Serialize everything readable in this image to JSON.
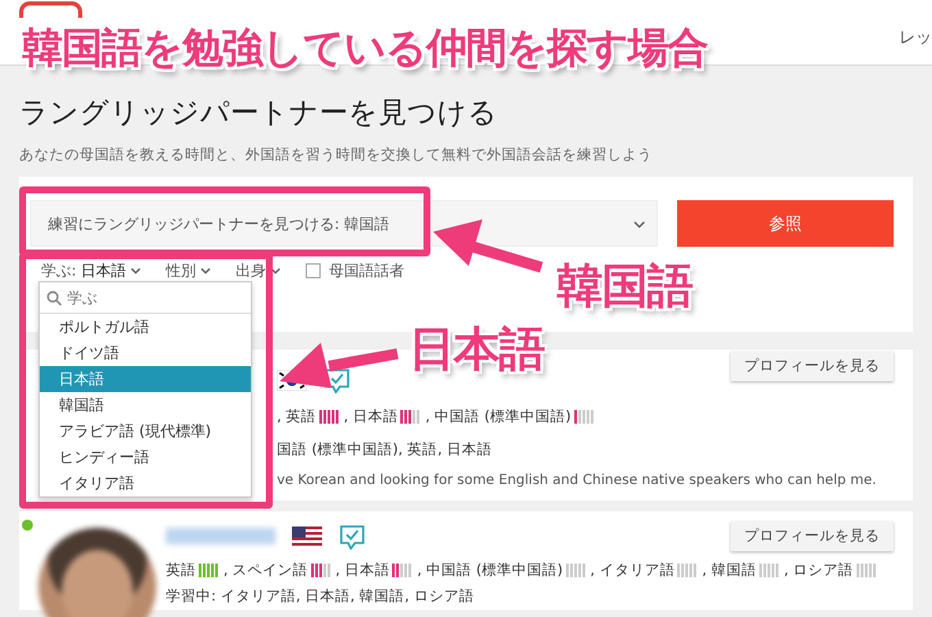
{
  "header": {
    "nav_item": "レッ"
  },
  "page": {
    "title": "ラングリッジパートナーを見つける",
    "subtitle": "あなたの母国語を教える時間と、外国語を習う時間を交換して無料で外国語会話を練習しよう"
  },
  "search": {
    "select_value": "練習にラングリッジパートナーを見つける: 韓国語",
    "button": "参照"
  },
  "filters": [
    {
      "kind": "dropdown",
      "label": "学ぶ: ",
      "value": "日本語"
    },
    {
      "kind": "dropdown",
      "label": "性別"
    },
    {
      "kind": "dropdown",
      "label": "出身"
    },
    {
      "kind": "checkbox",
      "label": "母国語話者",
      "checked": false
    }
  ],
  "language_menu": {
    "placeholder": "学ぶ",
    "items": [
      {
        "label": "ポルトガル語",
        "selected": false
      },
      {
        "label": "ドイツ語",
        "selected": false
      },
      {
        "label": "日本語",
        "selected": true
      },
      {
        "label": "韓国語",
        "selected": false
      },
      {
        "label": "アラビア語 (現代標準)",
        "selected": false
      },
      {
        "label": "ヒンディー語",
        "selected": false
      },
      {
        "label": "イタリア語",
        "selected": false
      }
    ]
  },
  "partners": [
    {
      "profile_button": "プロフィールを見る",
      "languages": [
        {
          "name": ", 英語",
          "level": 1,
          "color": "#e0307a"
        },
        {
          "name": ", 日本語",
          "level": 0.6,
          "color": "#e0307a"
        },
        {
          "name": ", 中国語 (標準中国語)",
          "level": 0.2,
          "color": "#e0307a"
        }
      ],
      "learning": "国語 (標準中国語), 英語, 日本語",
      "about": "ve Korean and looking for some English and Chinese native speakers who can help me."
    },
    {
      "online": true,
      "profile_button": "プロフィールを見る",
      "languages": [
        {
          "name": "英語",
          "level": 1,
          "color": "#6cc02a"
        },
        {
          "name": ", スペイン語",
          "level": 0.6,
          "color": "#e0307a"
        },
        {
          "name": ", 日本語",
          "level": 0.4,
          "color": "#e0307a"
        },
        {
          "name": ", 中国語 (標準中国語)"
        },
        {
          "name": ", イタリア語"
        },
        {
          "name": ", 韓国語"
        },
        {
          "name": ", ロシア語"
        }
      ],
      "learning": "学習中: イタリア語, 日本語, 韓国語, ロシア語"
    }
  ],
  "annotation": {
    "title": "韓国語を勉強している仲間を探す場合",
    "labels": [
      "韓国語",
      "日本語"
    ]
  }
}
